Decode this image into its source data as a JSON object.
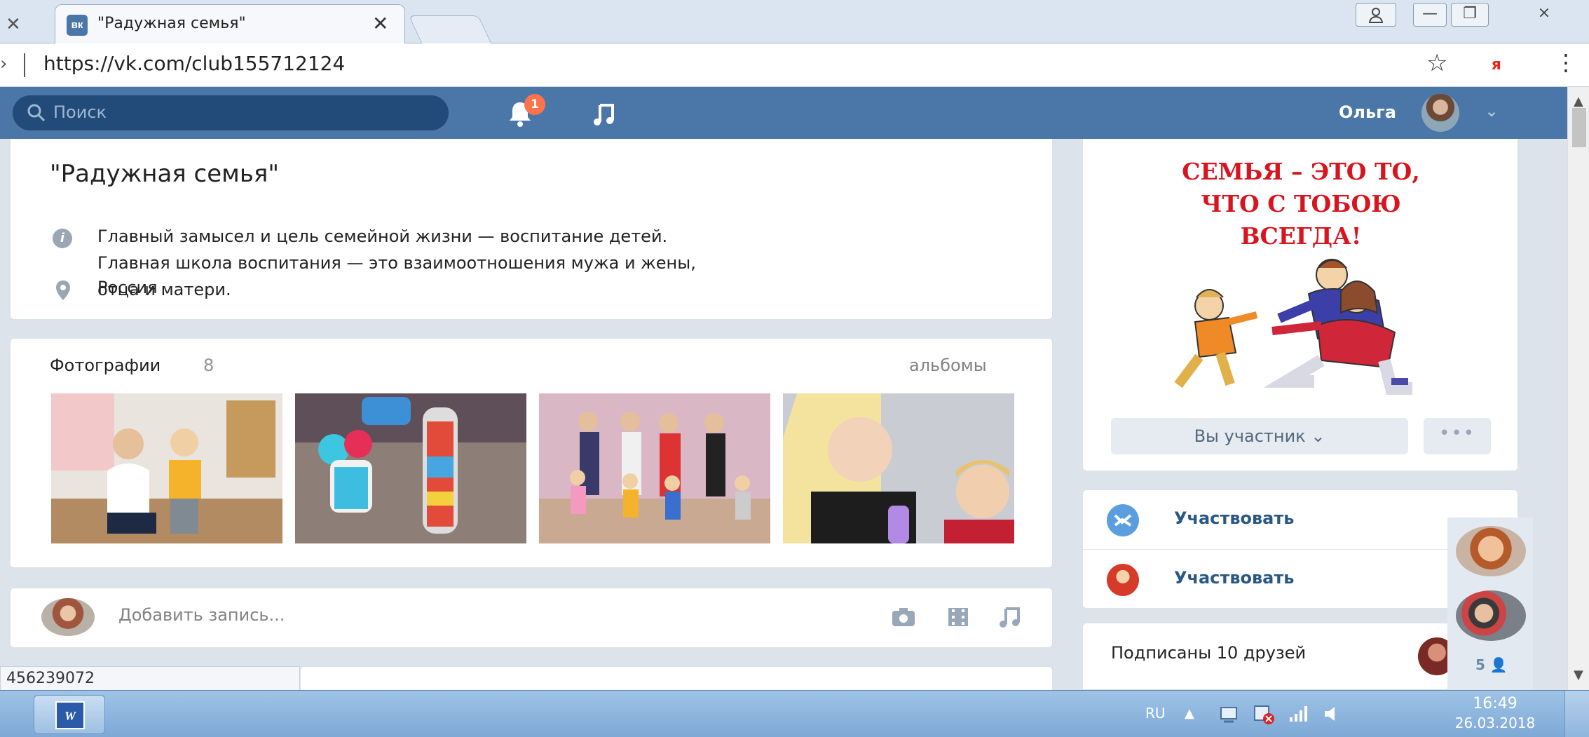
{
  "browser": {
    "tab_title": "\"Радужная семья\"",
    "tab_favicon": "вк",
    "url": "https://vk.com/club155712124",
    "yandex_label": "я"
  },
  "header": {
    "search_placeholder": "Поиск",
    "notification_count": "1",
    "user_name": "Ольга"
  },
  "group": {
    "title": "\"Радужная семья\"",
    "description": "Главный замысел и цель семейной жизни — воспитание детей. Главная школа воспитания — это взаимоотношения мужа и жены, отца и матери.",
    "location": "Россия"
  },
  "photos": {
    "label": "Фотографии",
    "count": "8",
    "albums_link": "альбомы"
  },
  "post": {
    "placeholder": "Добавить запись..."
  },
  "status_bar_text": "456239072",
  "sidebar": {
    "poster_lines": [
      "СЕМЬЯ – ЭТО ТО,",
      "ЧТО С ТОБОЮ",
      "ВСЕГДА!"
    ],
    "member_button": "Вы участник",
    "more_button": "•••",
    "apps": [
      {
        "label": "Участвовать"
      },
      {
        "label": "Участвовать"
      }
    ],
    "friends_text": "Подписаны 10 друзей",
    "side_count": "5"
  },
  "taskbar": {
    "language": "RU",
    "time": "16:49",
    "date": "26.03.2018"
  },
  "colors": {
    "vk_blue": "#4a76a8",
    "link_blue": "#2a5885",
    "poster_red": "#d8151f",
    "badge_orange": "#ff734c"
  }
}
